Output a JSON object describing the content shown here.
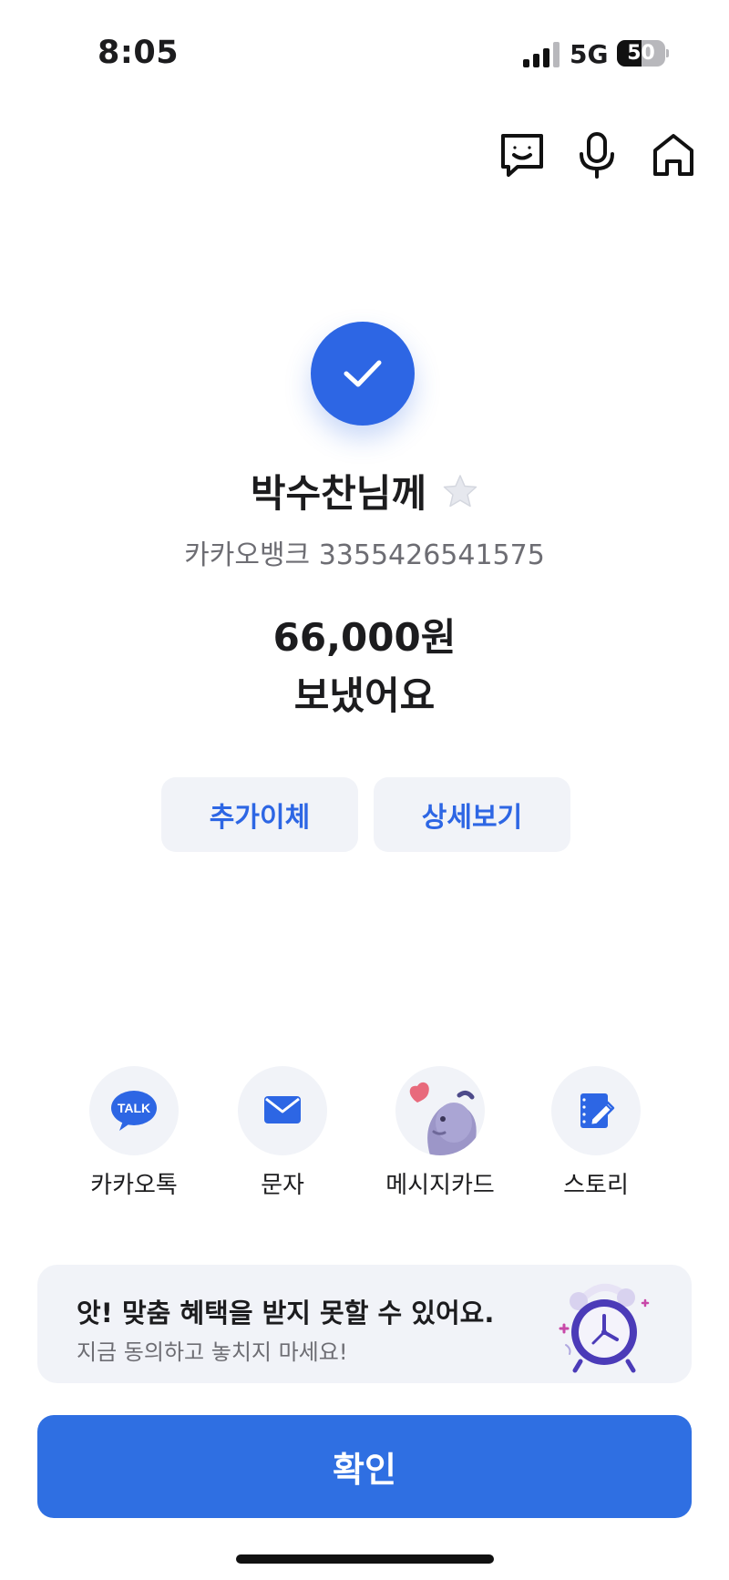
{
  "status_bar": {
    "time": "8:05",
    "network": "5G",
    "battery": "50",
    "battery_level": 0.5
  },
  "top_icons": [
    "chat-bubble-face-icon",
    "microphone-icon",
    "home-icon"
  ],
  "result": {
    "recipient": "박수찬님께",
    "account": "카카오뱅크 3355426541575",
    "amount": "66,000원",
    "message": "보냈어요"
  },
  "buttons": {
    "additional_transfer": "추가이체",
    "details": "상세보기",
    "confirm": "확인"
  },
  "share": {
    "items": [
      {
        "label": "카카오톡",
        "icon": "kakaotalk-icon",
        "icon_text": "TALK"
      },
      {
        "label": "문자",
        "icon": "envelope-icon"
      },
      {
        "label": "메시지카드",
        "icon": "message-card-character-icon"
      },
      {
        "label": "스토리",
        "icon": "story-edit-icon"
      }
    ]
  },
  "banner": {
    "title": "앗! 맞춤 혜택을 받지 못할 수 있어요.",
    "subtitle": "지금 동의하고 놓치지 마세요!"
  },
  "colors": {
    "accent": "#2d66e4",
    "button_bg": "#f1f3f8",
    "confirm": "#2f6fe2"
  }
}
